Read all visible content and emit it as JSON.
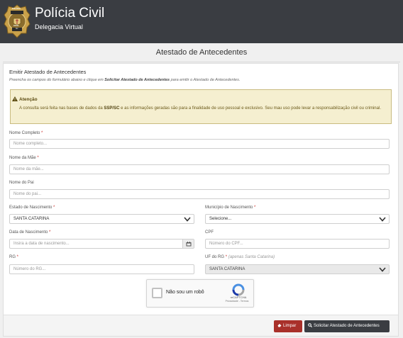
{
  "header": {
    "title": "Polícia Civil",
    "subtitle": "Delegacia Virtual",
    "badge_top_text": "POLÍCIA",
    "badge_bottom_text": "CIVIL",
    "badge_state": "SC"
  },
  "page": {
    "title": "Atestado de Antecedentes"
  },
  "section": {
    "title": "Emitir Atestado de Antecedentes",
    "desc_before": "Preencha os campos do formulário abaixo e clique em ",
    "desc_bold": "Solicitar Atestado de Antecedentes",
    "desc_after": " para emitir o Atestado de Antecedentes."
  },
  "alert": {
    "title": "Atenção",
    "text_before": "A consulta será feita nas bases de dados da ",
    "text_bold": "SSP/SC",
    "text_after": " e as informações geradas são para a finalidade de uso pessoal e exclusivo. Seu mau uso pode levar a responsabilização civil ou criminal."
  },
  "form": {
    "nome": {
      "label": "Nome Completo",
      "placeholder": "Nome completo..."
    },
    "mae": {
      "label": "Nome da Mãe",
      "placeholder": "Nome da mãe..."
    },
    "pai": {
      "label": "Nome do Pai",
      "placeholder": "Nome do pai..."
    },
    "estado": {
      "label": "Estado de Nascimento",
      "value": "SANTA CATARINA"
    },
    "municipio": {
      "label": "Município de Nascimento",
      "value": "Selecione..."
    },
    "data": {
      "label": "Data de Nascimento",
      "placeholder": "Insira a data de nascimento..."
    },
    "cpf": {
      "label": "CPF",
      "placeholder": "Número do CPF..."
    },
    "rg": {
      "label": "RG",
      "placeholder": "Número do RG..."
    },
    "uf_rg": {
      "label": "UF do RG",
      "hint": "(apenas Santa Catarina)",
      "value": "SANTA CATARINA"
    },
    "required_mark": "*"
  },
  "captcha": {
    "label": "Não sou um robô",
    "brand": "reCAPTCHA",
    "links": "Privacidade - Termos"
  },
  "buttons": {
    "clear": "Limpar",
    "submit": "Solicitar Atestado de Antecedentes"
  },
  "colors": {
    "header_bg": "#3a3d42",
    "danger": "#a9302a",
    "alert_bg": "#f5efd0",
    "required": "#c9302c"
  },
  "icons": [
    "police-badge-icon",
    "warning-icon",
    "chevron-down-icon",
    "calendar-icon",
    "recaptcha-icon",
    "eraser-icon",
    "search-icon"
  ]
}
